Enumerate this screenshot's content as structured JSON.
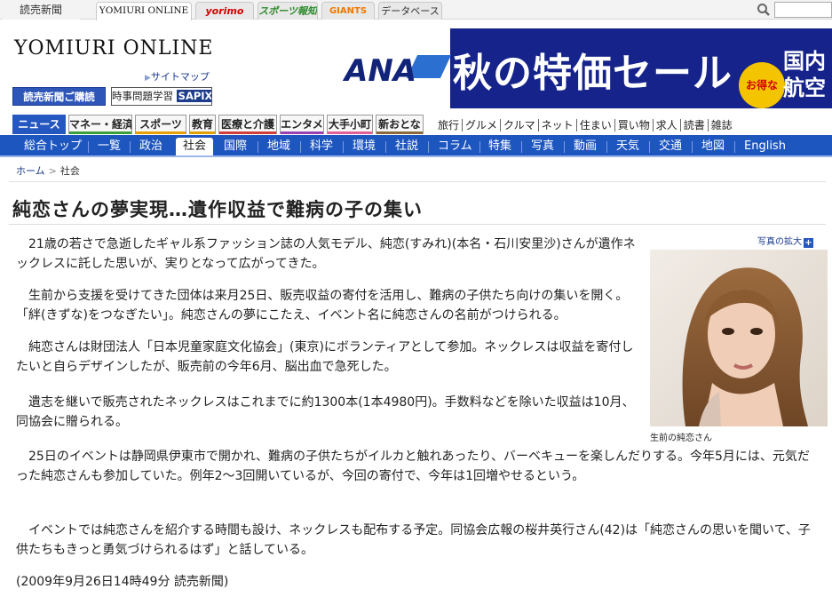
{
  "site_tabs": [
    {
      "label": "読売新聞"
    },
    {
      "label": "YOMIURI ONLINE"
    },
    {
      "label": "yorimo"
    },
    {
      "label": "スポーツ報知"
    },
    {
      "label": "GIANTS"
    },
    {
      "label": "データベース"
    }
  ],
  "search": {
    "icon": "search-icon",
    "placeholder": ""
  },
  "header": {
    "logo": "YOMIURI ONLINE",
    "sitemap": "サイトマップ",
    "btn_yomiuri": "読売新聞ご購読",
    "btn_sapix_prefix": "時事問題学習",
    "btn_sapix_brand": "SAPIX"
  },
  "ad": {
    "brand": "ANA",
    "headline": "秋の特価セール",
    "badge": "お得な",
    "domestic_1": "国内",
    "domestic_2": "航空"
  },
  "categories": [
    {
      "label": "ニュース"
    },
    {
      "label": "マネー・経済"
    },
    {
      "label": "スポーツ"
    },
    {
      "label": "教育"
    },
    {
      "label": "医療と介護"
    },
    {
      "label": "エンタメ"
    },
    {
      "label": "大手小町"
    },
    {
      "label": "新おとな"
    }
  ],
  "sub_categories": [
    "旅行",
    "グルメ",
    "クルマ",
    "ネット",
    "住まい",
    "買い物",
    "求人",
    "読書",
    "雑誌"
  ],
  "nav": [
    "総合トップ",
    "一覧",
    "政治",
    "社会",
    "国際",
    "地域",
    "科学",
    "環境",
    "社説",
    "コラム",
    "特集",
    "写真",
    "動画",
    "天気",
    "交通",
    "地図",
    "English"
  ],
  "breadcrumb": {
    "home": "ホーム",
    "sep": ">",
    "current": "社会"
  },
  "article": {
    "headline": "純恋さんの夢実現…遺作収益で難病の子の集い",
    "p1": "21歳の若さで急逝したギャル系ファッション誌の人気モデル、純恋(すみれ)(本名・石川安里沙)さんが遺作ネックレスに託した思いが、実りとなって広がってきた。",
    "p2": "生前から支援を受けてきた団体は来月25日、販売収益の寄付を活用し、難病の子供たち向けの集いを開く。「絆(きずな)をつなぎたい」。純恋さんの夢にこたえ、イベント名に純恋さんの名前がつけられる。",
    "p3": "純恋さんは財団法人「日本児童家庭文化協会」(東京)にボランティアとして参加。ネックレスは収益を寄付したいと自らデザインしたが、販売前の今年6月、脳出血で急死した。",
    "p4": "遺志を継いで販売されたネックレスはこれまでに約1300本(1本4980円)。手数料などを除いた収益は10月、同協会に贈られる。",
    "p5": "25日のイベントは静岡県伊東市で開かれ、難病の子供たちがイルカと触れあったり、バーベキューを楽しんだりする。今年5月には、元気だった純恋さんも参加していた。例年2～3回開いているが、今回の寄付で、今年は1回増やせるという。",
    "p6": "イベントでは純恋さんを紹介する時間も設け、ネックレスも配布する予定。同協会広報の桜井英行さん(42)は「純恋さんの思いを聞いて、子供たちもきっと勇気づけられるはず」と話している。",
    "byline": "(2009年9月26日14時49分  読売新聞)"
  },
  "photo": {
    "enlarge": "写真の拡大",
    "caption": "生前の純恋さん"
  }
}
